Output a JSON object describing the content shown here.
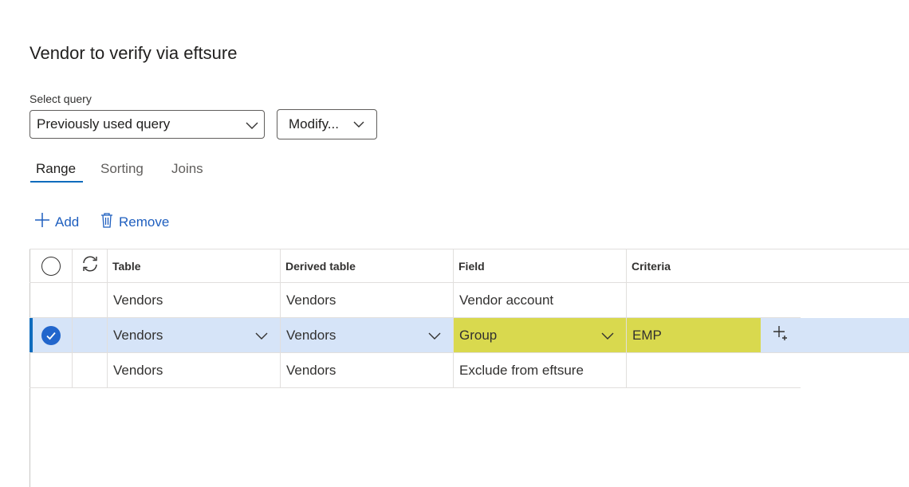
{
  "page": {
    "title": "Vendor to verify via eftsure"
  },
  "query": {
    "label": "Select query",
    "selected": "Previously used query",
    "modify_label": "Modify..."
  },
  "tabs": [
    {
      "label": "Range",
      "active": true
    },
    {
      "label": "Sorting",
      "active": false
    },
    {
      "label": "Joins",
      "active": false
    }
  ],
  "actions": {
    "add": "Add",
    "remove": "Remove"
  },
  "grid": {
    "columns": [
      "Table",
      "Derived table",
      "Field",
      "Criteria"
    ],
    "rows": [
      {
        "table": "Vendors",
        "derived_table": "Vendors",
        "field": "Vendor account",
        "criteria": "",
        "selected": false
      },
      {
        "table": "Vendors",
        "derived_table": "Vendors",
        "field": "Group",
        "criteria": "EMP",
        "selected": true
      },
      {
        "table": "Vendors",
        "derived_table": "Vendors",
        "field": "Exclude from eftsure",
        "criteria": "",
        "selected": false
      }
    ]
  },
  "colors": {
    "accent": "#0f6cbd",
    "selected_row": "#d6e4f8",
    "highlight": "#d9d94e",
    "link": "#1f5fbf"
  }
}
